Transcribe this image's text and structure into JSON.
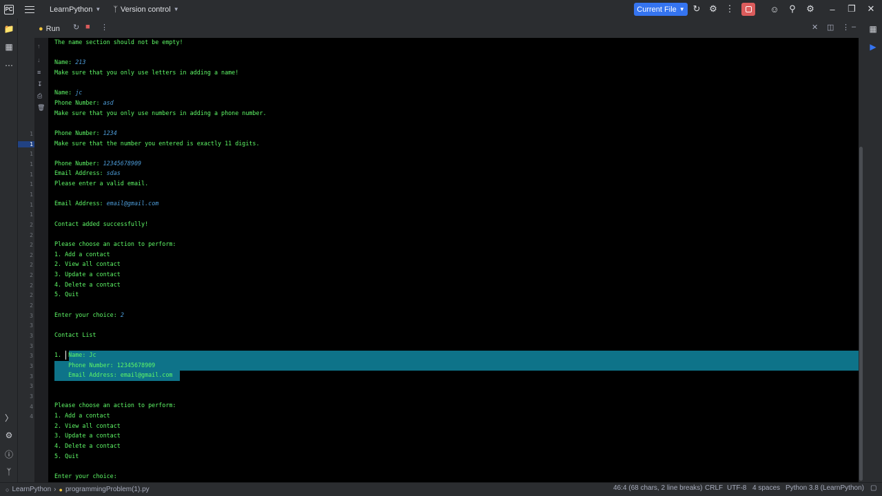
{
  "titlebar": {
    "project": "LearnPython",
    "vcs": "Version control",
    "run_config": "Current File"
  },
  "toolwindow": {
    "tab_label": "Run"
  },
  "gutter": [
    "1",
    "1",
    "1",
    "1",
    "1",
    "1",
    "1",
    "1",
    "1",
    "2",
    "2",
    "2",
    "2",
    "2",
    "2",
    "2",
    "2",
    "2",
    "3",
    "3",
    "3",
    "3",
    "3",
    "3",
    "3",
    "3",
    "3",
    "4",
    "4"
  ],
  "console": {
    "lines": [
      {
        "text": "The name section should not be empty!",
        "input": ""
      },
      {
        "text": "",
        "input": ""
      },
      {
        "text": "Name: ",
        "input": "213"
      },
      {
        "text": "Make sure that you only use letters in adding a name!",
        "input": ""
      },
      {
        "text": "",
        "input": ""
      },
      {
        "text": "Name: ",
        "input": "jc"
      },
      {
        "text": "Phone Number: ",
        "input": "asd"
      },
      {
        "text": "Make sure that you only use numbers in adding a phone number.",
        "input": ""
      },
      {
        "text": "",
        "input": ""
      },
      {
        "text": "Phone Number: ",
        "input": "1234"
      },
      {
        "text": "Make sure that the number you entered is exactly 11 digits.",
        "input": ""
      },
      {
        "text": "",
        "input": ""
      },
      {
        "text": "Phone Number: ",
        "input": "12345678909"
      },
      {
        "text": "Email Address: ",
        "input": "sdas"
      },
      {
        "text": "Please enter a valid email.",
        "input": ""
      },
      {
        "text": "",
        "input": ""
      },
      {
        "text": "Email Address: ",
        "input": "email@gmail.com"
      },
      {
        "text": "",
        "input": ""
      },
      {
        "text": "Contact added successfully!",
        "input": ""
      },
      {
        "text": "",
        "input": ""
      },
      {
        "text": "Please choose an action to perform:",
        "input": ""
      },
      {
        "text": "1. Add a contact",
        "input": ""
      },
      {
        "text": "2. View all contact",
        "input": ""
      },
      {
        "text": "3. Update a contact",
        "input": ""
      },
      {
        "text": "4. Delete a contact",
        "input": ""
      },
      {
        "text": "5. Quit",
        "input": ""
      },
      {
        "text": "",
        "input": ""
      },
      {
        "text": "Enter your choice: ",
        "input": "2"
      },
      {
        "text": "",
        "input": ""
      },
      {
        "text": "Contact List",
        "input": ""
      },
      {
        "text": "",
        "input": ""
      },
      {
        "text": "1.  Name: Jc",
        "input": ""
      },
      {
        "text": "    Phone Number: 12345678909",
        "input": ""
      },
      {
        "text": "    Email Address: email@gmail.com",
        "input": ""
      },
      {
        "text": "",
        "input": ""
      },
      {
        "text": "",
        "input": ""
      },
      {
        "text": "Please choose an action to perform:",
        "input": ""
      },
      {
        "text": "1. Add a contact",
        "input": ""
      },
      {
        "text": "2. View all contact",
        "input": ""
      },
      {
        "text": "3. Update a contact",
        "input": ""
      },
      {
        "text": "4. Delete a contact",
        "input": ""
      },
      {
        "text": "5. Quit",
        "input": ""
      },
      {
        "text": "",
        "input": ""
      },
      {
        "text": "Enter your choice:",
        "input": ""
      }
    ]
  },
  "statusbar": {
    "project": "LearnPython",
    "file": "programmingProblem(1).py",
    "position": "46:4 (68 chars, 2 line breaks)",
    "line_sep": "CRLF",
    "encoding": "UTF-8",
    "indent": "4 spaces",
    "interpreter": "Python 3.8 (LearnPython)"
  },
  "colors": {
    "accent": "#3574f0",
    "console_text": "#5ff967",
    "console_input": "#4d9cd8",
    "selection": "#0e7389",
    "stop": "#db5c5c"
  }
}
